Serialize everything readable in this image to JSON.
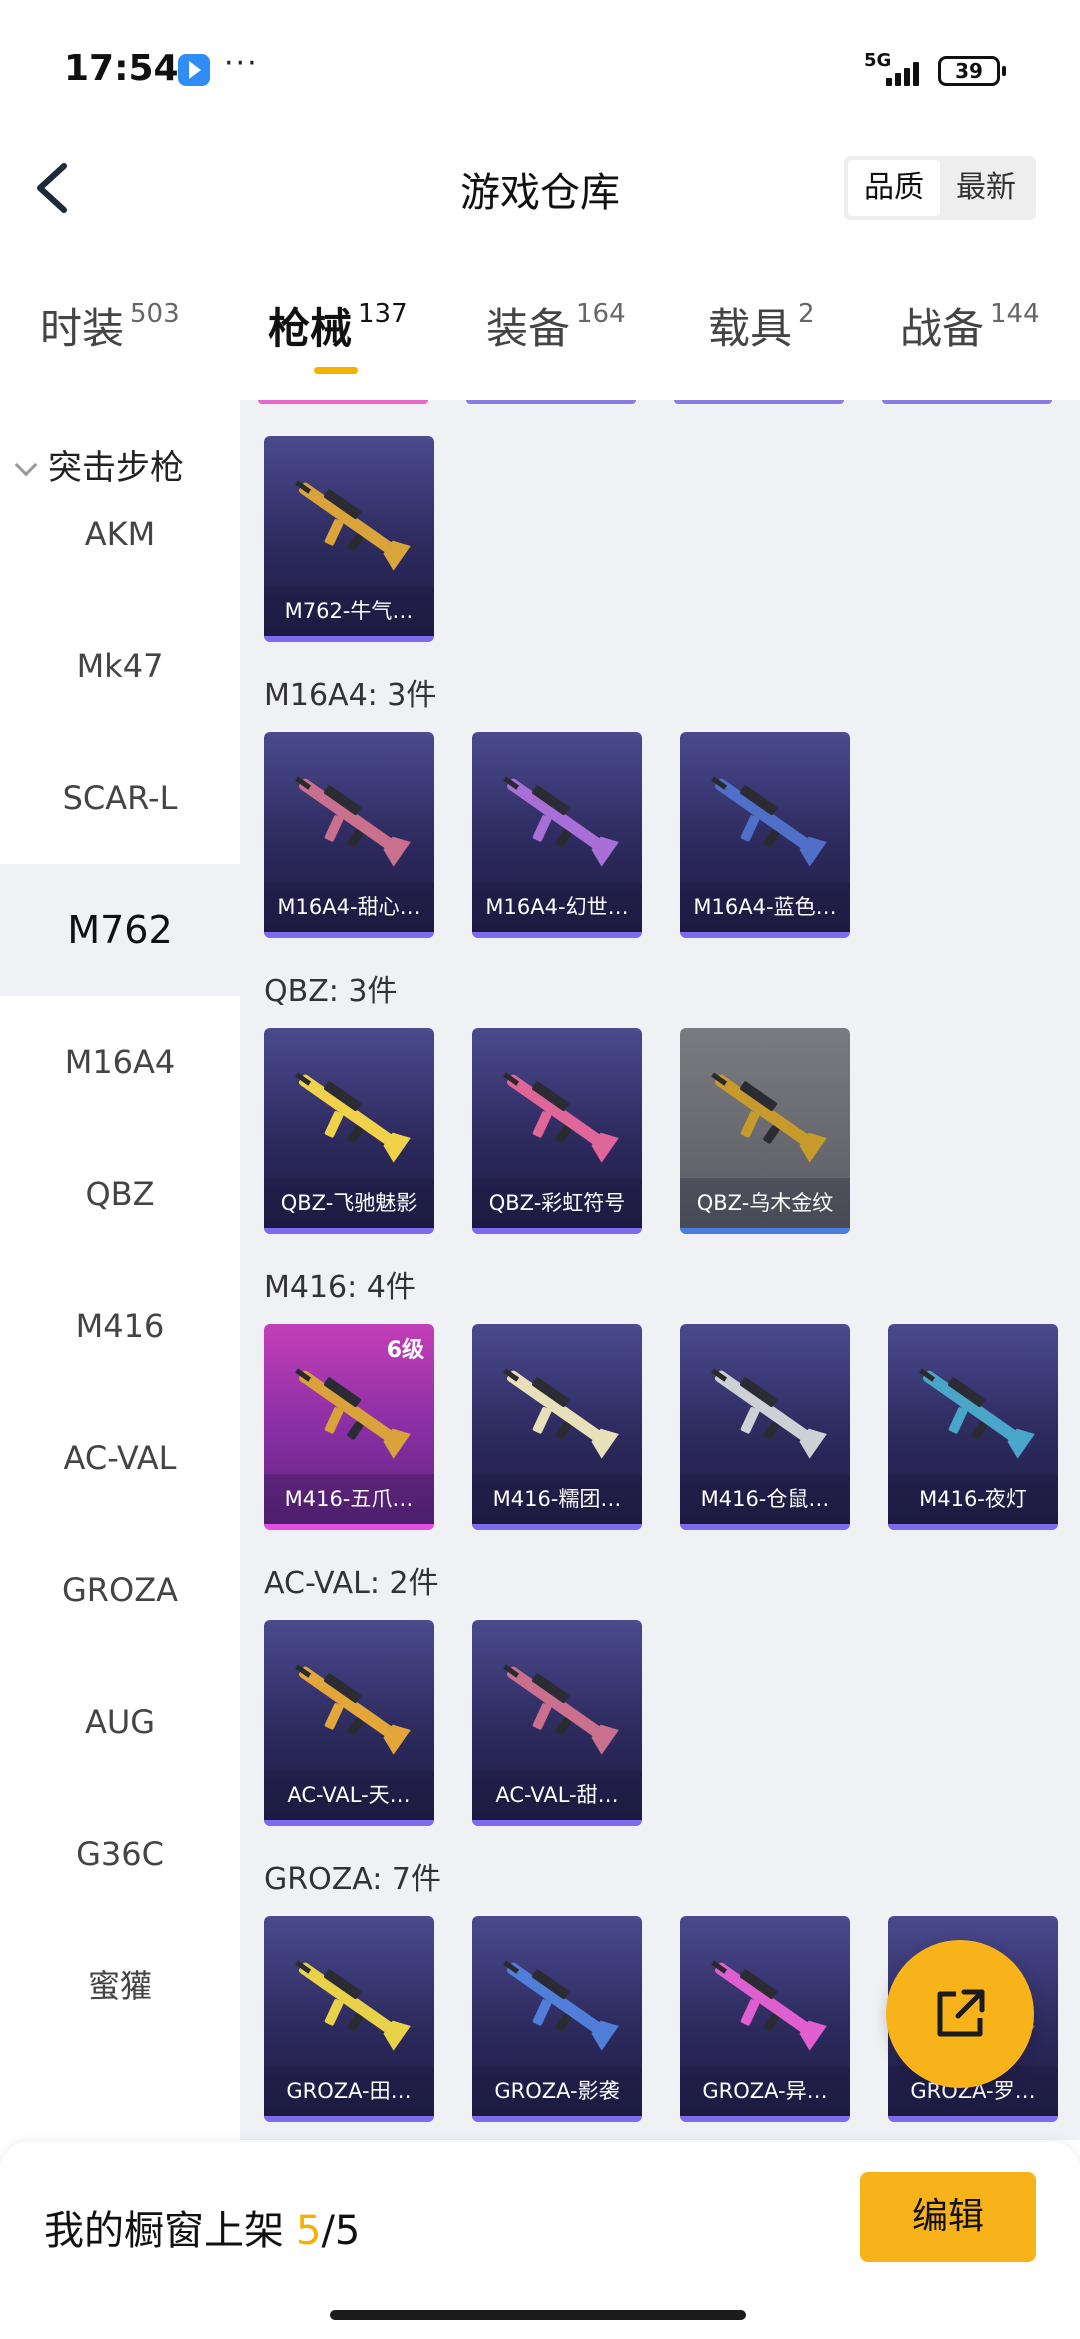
{
  "status_bar": {
    "time": "17:54",
    "network": "5G",
    "battery": "39",
    "more": "···"
  },
  "header": {
    "title": "游戏仓库",
    "sort_options": [
      "品质",
      "最新"
    ],
    "active_sort": "品质"
  },
  "tabs": [
    {
      "label": "时装",
      "count": "503"
    },
    {
      "label": "枪械",
      "count": "137"
    },
    {
      "label": "装备",
      "count": "164"
    },
    {
      "label": "载具",
      "count": "2"
    },
    {
      "label": "战备",
      "count": "144"
    }
  ],
  "active_tab": "枪械",
  "sidebar": {
    "header": "突击步枪",
    "items": [
      "AKM",
      "Mk47",
      "SCAR-L",
      "M762",
      "M16A4",
      "QBZ",
      "M416",
      "AC-VAL",
      "GROZA",
      "AUG",
      "G36C",
      "蜜獾"
    ],
    "active": "M762"
  },
  "groups": [
    {
      "title": "",
      "items": [
        {
          "name": "M762-牛气…",
          "style": "purple",
          "gun_color": "#d9a53a"
        }
      ]
    },
    {
      "title": "M16A4: 3件",
      "items": [
        {
          "name": "M16A4-甜心…",
          "style": "purple",
          "gun_color": "#c9708e"
        },
        {
          "name": "M16A4-幻世…",
          "style": "purple",
          "gun_color": "#a86fd6"
        },
        {
          "name": "M16A4-蓝色…",
          "style": "purple",
          "gun_color": "#4f6fc9"
        }
      ]
    },
    {
      "title": "QBZ: 3件",
      "items": [
        {
          "name": "QBZ-飞驰魅影",
          "style": "purple",
          "gun_color": "#f0d24a"
        },
        {
          "name": "QBZ-彩虹符号",
          "style": "purple",
          "gun_color": "#e0669a"
        },
        {
          "name": "QBZ-乌木金纹",
          "style": "grey",
          "gun_color": "#c79a2c"
        }
      ]
    },
    {
      "title": "M416: 4件",
      "items": [
        {
          "name": "M416-五爪…",
          "style": "pink",
          "gun_color": "#d9a23a",
          "level": "6级"
        },
        {
          "name": "M416-糯团…",
          "style": "purple",
          "gun_color": "#e8e0b8"
        },
        {
          "name": "M416-仓鼠…",
          "style": "purple",
          "gun_color": "#cfcfd6"
        },
        {
          "name": "M416-夜灯",
          "style": "purple",
          "gun_color": "#4aa6c9"
        }
      ]
    },
    {
      "title": "AC-VAL: 2件",
      "items": [
        {
          "name": "AC-VAL-天…",
          "style": "purple",
          "gun_color": "#e2a63a"
        },
        {
          "name": "AC-VAL-甜…",
          "style": "purple",
          "gun_color": "#c9708e"
        }
      ]
    },
    {
      "title": "GROZA: 7件",
      "items": [
        {
          "name": "GROZA-田…",
          "style": "purple",
          "gun_color": "#e8d24a"
        },
        {
          "name": "GROZA-影袭",
          "style": "purple",
          "gun_color": "#4f7fd9"
        },
        {
          "name": "GROZA-异…",
          "style": "purple",
          "gun_color": "#e05fd0"
        },
        {
          "name": "GROZA-罗…",
          "style": "purple",
          "gun_color": "#8a7be0"
        }
      ]
    }
  ],
  "bottom_bar": {
    "shelf_label": "我的橱窗上架",
    "shelf_count": "5",
    "shelf_total": "/5",
    "edit_label": "编辑"
  },
  "colors": {
    "accent": "#f8b21a",
    "tab_indicator": "#f5b100",
    "content_bg": "#f0f1f5"
  }
}
